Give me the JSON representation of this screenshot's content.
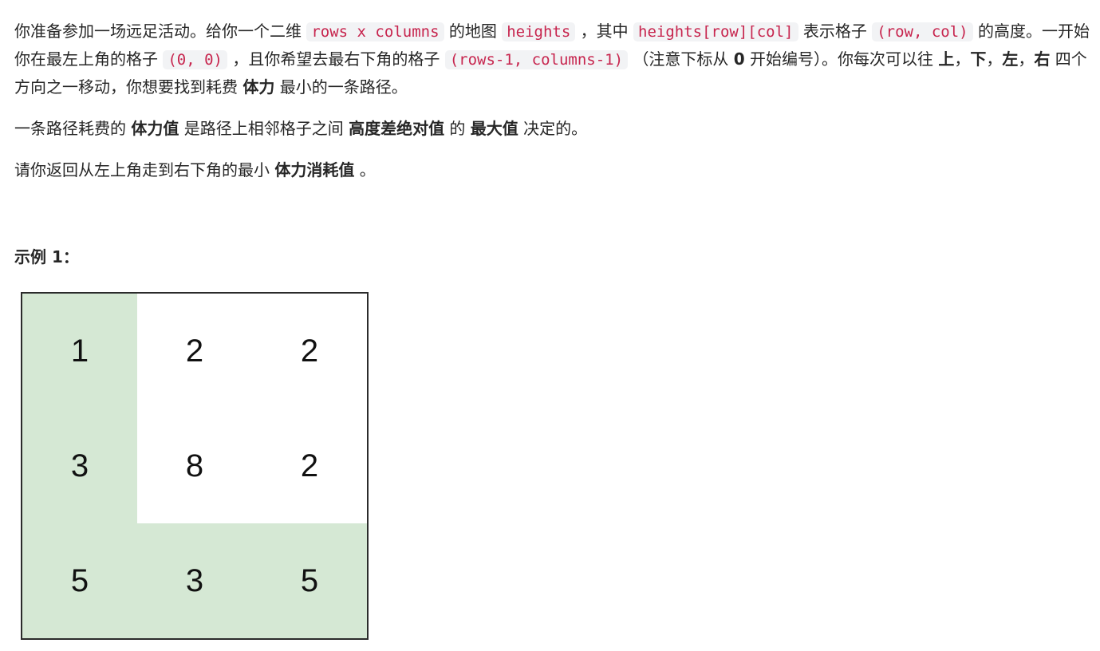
{
  "problem": {
    "p1": {
      "t1": "你准备参加一场远足活动。给你一个二维 ",
      "c1": "rows x columns",
      "t2": " 的地图 ",
      "c2": "heights",
      "t3": " ，其中 ",
      "c3": "heights[row][col]",
      "t4": " 表示格子 ",
      "c4": "(row, col)",
      "t5": " 的高度。一开始你在最左上角的格子 ",
      "c5": "(0, 0)",
      "t6": " ，且你希望去最右下角的格子 ",
      "c6": "(rows-1, columns-1)",
      "t7": " （注意下标从 ",
      "b1": "0",
      "t8": " 开始编号）。你每次可以往 ",
      "b2": "上",
      "t9": "，",
      "b3": "下",
      "t10": "，",
      "b4": "左",
      "t11": "，",
      "b5": "右",
      "t12": " 四个方向之一移动，你想要找到耗费 ",
      "b6": "体力",
      "t13": " 最小的一条路径。"
    },
    "p2": {
      "t1": "一条路径耗费的 ",
      "b1": "体力值",
      "t2": " 是路径上相邻格子之间 ",
      "b2": "高度差绝对值",
      "t3": " 的 ",
      "b3": "最大值",
      "t4": " 决定的。"
    },
    "p3": {
      "t1": "请你返回从左上角走到右下角的最小 ",
      "b1": "体力消耗值",
      "t2": " 。"
    }
  },
  "example": {
    "title": "示例 1：",
    "grid": [
      [
        {
          "value": "1",
          "on_path": true
        },
        {
          "value": "2",
          "on_path": false
        },
        {
          "value": "2",
          "on_path": false
        }
      ],
      [
        {
          "value": "3",
          "on_path": true
        },
        {
          "value": "8",
          "on_path": false
        },
        {
          "value": "2",
          "on_path": false
        }
      ],
      [
        {
          "value": "5",
          "on_path": true
        },
        {
          "value": "3",
          "on_path": true
        },
        {
          "value": "5",
          "on_path": true
        }
      ]
    ],
    "colors": {
      "path_fill": "#d5e8d4",
      "default_fill": "#ffffff",
      "border": "#2b2b2b"
    }
  }
}
